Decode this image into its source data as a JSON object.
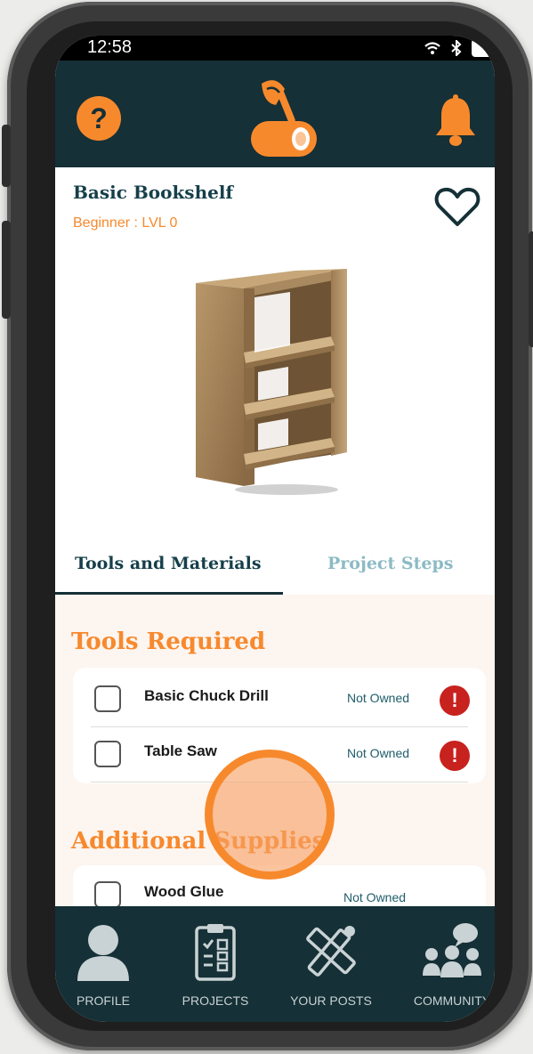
{
  "status": {
    "time": "12:58"
  },
  "project": {
    "title": "Basic Bookshelf",
    "level": "Beginner : LVL 0"
  },
  "tabs": [
    {
      "label": "Tools and Materials",
      "active": true
    },
    {
      "label": "Project Steps",
      "active": false
    }
  ],
  "tools_section": {
    "title": "Tools Required",
    "items": [
      {
        "name": "Basic Chuck Drill",
        "status": "Not Owned"
      },
      {
        "name": "Table Saw",
        "status": "Not Owned"
      }
    ]
  },
  "supplies_section": {
    "title": "Additional Supplies",
    "items": [
      {
        "name": "Wood Glue",
        "status": "Not Owned"
      }
    ]
  },
  "bottom_nav": [
    {
      "label": "PROFILE",
      "icon": "profile-icon"
    },
    {
      "label": "PROJECTS",
      "icon": "clipboard-icon"
    },
    {
      "label": "YOUR POSTS",
      "icon": "pencil-ruler-icon"
    },
    {
      "label": "COMMUNITY",
      "icon": "community-icon"
    }
  ],
  "colors": {
    "header_bg": "#153036",
    "accent": "#f7892d",
    "alert": "#c8221e",
    "inactive_tab": "#8cbac4"
  }
}
